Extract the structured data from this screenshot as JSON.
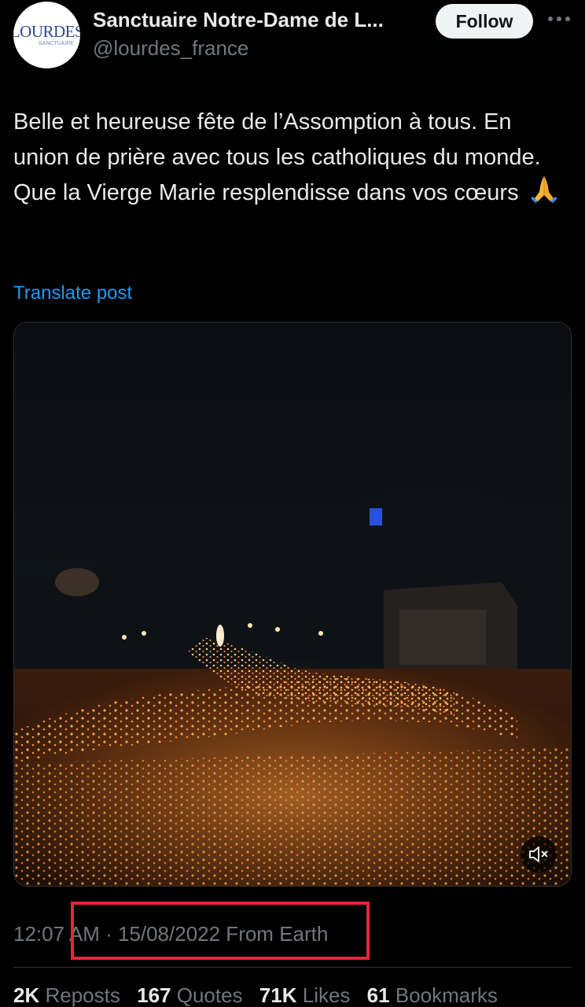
{
  "account": {
    "display_name": "Sanctuaire Notre-Dame de L...",
    "handle": "@lourdes_france",
    "avatar_text": "LOURDES",
    "avatar_subtext": "SANCTUAIRE",
    "follow_label": "Follow",
    "more_icon": "more-horizontal-icon"
  },
  "post": {
    "text": "Belle et heureuse fête de l’Assomption à tous. En union de prière avec tous les catholiques du monde. Que la Vierge Marie resplendisse dans vos cœurs",
    "emoji": "🙏",
    "translate_label": "Translate post",
    "media": {
      "kind": "video",
      "mute_icon": "muted-speaker-icon"
    },
    "meta": "12:07 AM · 15/08/2022 From Earth"
  },
  "stats": {
    "reposts_count": "2K",
    "reposts_label": "Reposts",
    "quotes_count": "167",
    "quotes_label": "Quotes",
    "likes_count": "71K",
    "likes_label": "Likes",
    "bookmarks_count": "61",
    "bookmarks_label": "Bookmarks"
  },
  "colors": {
    "background": "#000000",
    "text": "#e7e9ea",
    "muted": "#71767b",
    "link": "#1d9bf0",
    "highlight": "#e8253a"
  }
}
